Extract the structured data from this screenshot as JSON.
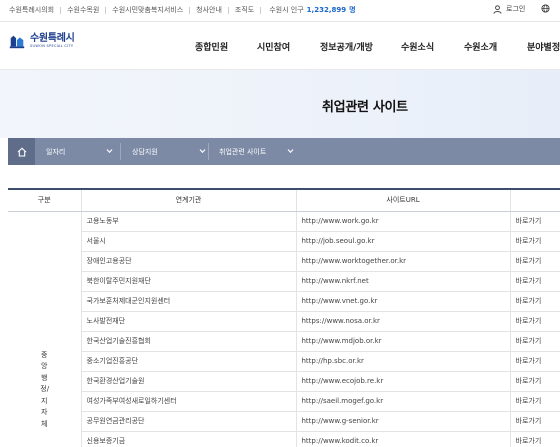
{
  "topbar": {
    "links": [
      "수원특례시의회",
      "수원수목원",
      "수원시민맞춤복지서비스",
      "청사안내",
      "조직도"
    ],
    "population_label": "수원시 인구",
    "population_value": "1,232,899",
    "population_unit": "명",
    "login_label": "로그인"
  },
  "header": {
    "logo_ko": "수원특례시",
    "logo_en": "SUWON SPECIAL CITY",
    "gnb": [
      "종합민원",
      "시민참여",
      "정보공개/개방",
      "수원소식",
      "수원소개",
      "분야별정"
    ]
  },
  "page_title": "취업관련 사이트",
  "location": {
    "items": [
      "일자리",
      "상담지원",
      "취업관련 사이트"
    ]
  },
  "table": {
    "headers": [
      "구분",
      "연계기관",
      "사이트URL",
      "바로"
    ],
    "category": "중앙행정/지자체",
    "rows": [
      {
        "org": "고용노동부",
        "url": "http://www.work.go.kr",
        "go": "바로가기"
      },
      {
        "org": "서울시",
        "url": "http://job.seoul.go.kr",
        "go": "바로가기"
      },
      {
        "org": "장애인고용공단",
        "url": "http://www.worktogether.or.kr",
        "go": "바로가기"
      },
      {
        "org": "북한이탈주민지원재단",
        "url": "http://www.nkrf.net",
        "go": "바로가기"
      },
      {
        "org": "국가보훈처제대군인지원센터",
        "url": "http://www.vnet.go.kr",
        "go": "바로가기"
      },
      {
        "org": "노사발전재단",
        "url": "https://www.nosa.or.kr",
        "go": "바로가기"
      },
      {
        "org": "한국산업기술진흥협회",
        "url": "http://www.mdjob.or.kr",
        "go": "바로가기"
      },
      {
        "org": "중소기업진흥공단",
        "url": "http://hp.sbc.or.kr",
        "go": "바로가기"
      },
      {
        "org": "한국환경산업기술원",
        "url": "http://www.ecojob.re.kr",
        "go": "바로가기"
      },
      {
        "org": "여성가족부여성새로일하기센터",
        "url": "http://saeil.mogef.go.kr",
        "go": "바로가기"
      },
      {
        "org": "공무원연금관리공단",
        "url": "http://www.g-senior.kr",
        "go": "바로가기"
      },
      {
        "org": "신용보증기금",
        "url": "http://www.kodit.co.kr",
        "go": "바로가기"
      }
    ]
  },
  "icons": {
    "user": "user-icon",
    "globe": "globe-icon",
    "home": "home-icon",
    "chevron": "chevron-down-icon"
  },
  "colors": {
    "accent_blue": "#1a66c8",
    "logo_navy": "#1d3f8f",
    "location_bar": "#7c8aa6",
    "table_top_border": "#3c4d6e"
  }
}
